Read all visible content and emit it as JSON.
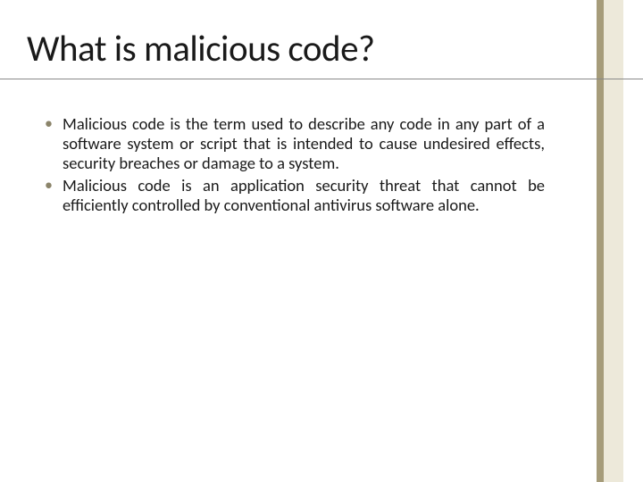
{
  "title": "What is malicious code?",
  "bullets": [
    "Malicious code is the term used to describe any code in any part of a software system or script that is intended to cause undesired effects, security breaches or damage to a system.",
    "Malicious code is an application security threat that cannot be efficiently controlled by conventional antivirus software alone."
  ],
  "colors": {
    "accent_dark": "#A69C7A",
    "accent_light": "#EDE9DA",
    "bullet": "#8B846A"
  }
}
